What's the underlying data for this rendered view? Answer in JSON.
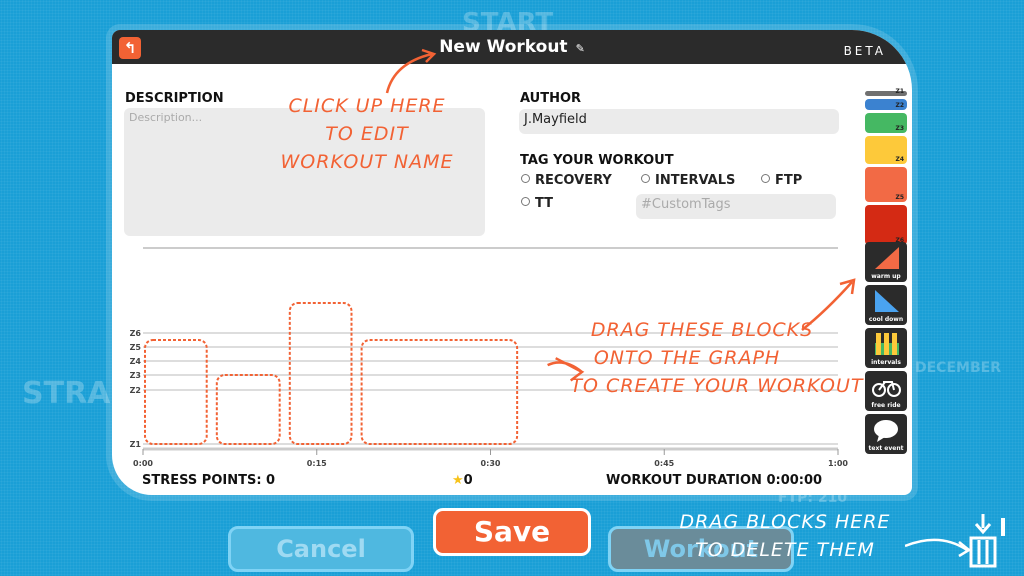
{
  "background": {
    "start": "START",
    "stra": "STRA",
    "december": "DECEMBER",
    "ftp": "FTP: 210"
  },
  "header": {
    "title": "New Workout",
    "edit_icon": "pencil-square-icon",
    "back_icon": "back-arrow-icon",
    "beta": "BETA"
  },
  "description": {
    "label": "DESCRIPTION",
    "placeholder": "Description..."
  },
  "author": {
    "label": "AUTHOR",
    "value": "J.Mayfield"
  },
  "tags": {
    "label": "TAG YOUR WORKOUT",
    "options": [
      "RECOVERY",
      "INTERVALS",
      "FTP",
      "TT"
    ],
    "custom_placeholder": "#CustomTags"
  },
  "hints": {
    "edit_name": [
      "CLICK UP HERE",
      "TO EDIT",
      "WORKOUT NAME"
    ],
    "drag": [
      "DRAG THESE BLOCKS",
      "ONTO THE GRAPH",
      "TO CREATE YOUR WORKOUT"
    ],
    "delete": [
      "DRAG BLOCKS HERE",
      "TO DELETE THEM"
    ]
  },
  "palette": {
    "zones": [
      {
        "label": "Z1",
        "color": "#707070"
      },
      {
        "label": "Z2",
        "color": "#3b82d0"
      },
      {
        "label": "Z3",
        "color": "#45b863"
      },
      {
        "label": "Z4",
        "color": "#fdc93a"
      },
      {
        "label": "Z5",
        "color": "#f26a45"
      },
      {
        "label": "Z6",
        "color": "#d42a14"
      }
    ],
    "tools": [
      {
        "label": "warm up",
        "icon": "warm-up-ramp-icon"
      },
      {
        "label": "cool down",
        "icon": "cool-down-ramp-icon"
      },
      {
        "label": "intervals",
        "icon": "intervals-icon"
      },
      {
        "label": "free ride",
        "icon": "bicycle-icon"
      },
      {
        "label": "text event",
        "icon": "speech-bubble-icon"
      }
    ]
  },
  "chart_data": {
    "type": "bar",
    "y_ticks": [
      "Z1",
      "Z2",
      "Z3",
      "Z4",
      "Z5",
      "Z6"
    ],
    "x_ticks": [
      "0:00",
      "0:15",
      "0:30",
      "0:45",
      "1:00"
    ],
    "xlim_minutes": [
      0,
      60
    ],
    "placeholder_blocks": [
      {
        "start": 0,
        "end": 5.5,
        "zone": 5.5
      },
      {
        "start": 6.2,
        "end": 11.8,
        "zone": 3
      },
      {
        "start": 12.5,
        "end": 18,
        "zone": 7
      },
      {
        "start": 18.7,
        "end": 32.3,
        "zone": 5.5
      }
    ],
    "accent": "#f26234"
  },
  "footer": {
    "stress_label": "STRESS POINTS: 0",
    "stars": "0",
    "duration": "WORKOUT DURATION 0:00:00"
  },
  "buttons": {
    "cancel": "Cancel",
    "save": "Save",
    "workout": "Workout"
  },
  "trash_icon": "trash-icon"
}
